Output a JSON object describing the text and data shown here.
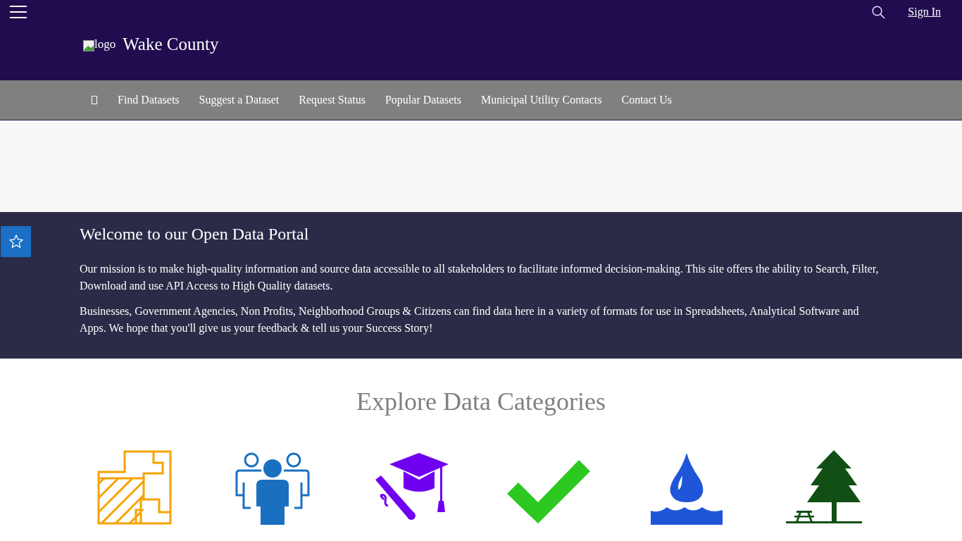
{
  "header": {
    "logo_alt": "logo",
    "title": "Wake County",
    "sign_in": "Sign In"
  },
  "nav": {
    "items": [
      {
        "kind": "glyph"
      },
      {
        "kind": "link",
        "label": "Find Datasets"
      },
      {
        "kind": "link",
        "label": "Suggest a Dataset"
      },
      {
        "kind": "link",
        "label": "Request Status"
      },
      {
        "kind": "link",
        "label": "Popular Datasets"
      },
      {
        "kind": "link",
        "label": "Municipal Utility Contacts"
      },
      {
        "kind": "link",
        "label": "Contact Us"
      }
    ]
  },
  "welcome": {
    "title": "Welcome to our Open Data Portal",
    "paragraphs": [
      "Our mission is to make high-quality information and source data accessible to all stakeholders to facilitate informed decision-making. This site offers the ability to Search, Filter, Download and use API Access to High Quality datasets.",
      "Businesses, Government Agencies, Non Profits, Neighborhood Groups & Citizens can find data here in a variety of formats for use in Spreadsheets, Analytical Software and Apps. We hope that you'll give us your feedback & tell us your Success Story!"
    ]
  },
  "categories": {
    "title": "Explore Data Categories",
    "items": [
      {
        "kind": "parcels"
      },
      {
        "kind": "people"
      },
      {
        "kind": "education"
      },
      {
        "kind": "check"
      },
      {
        "kind": "water"
      },
      {
        "kind": "parks"
      }
    ]
  }
}
